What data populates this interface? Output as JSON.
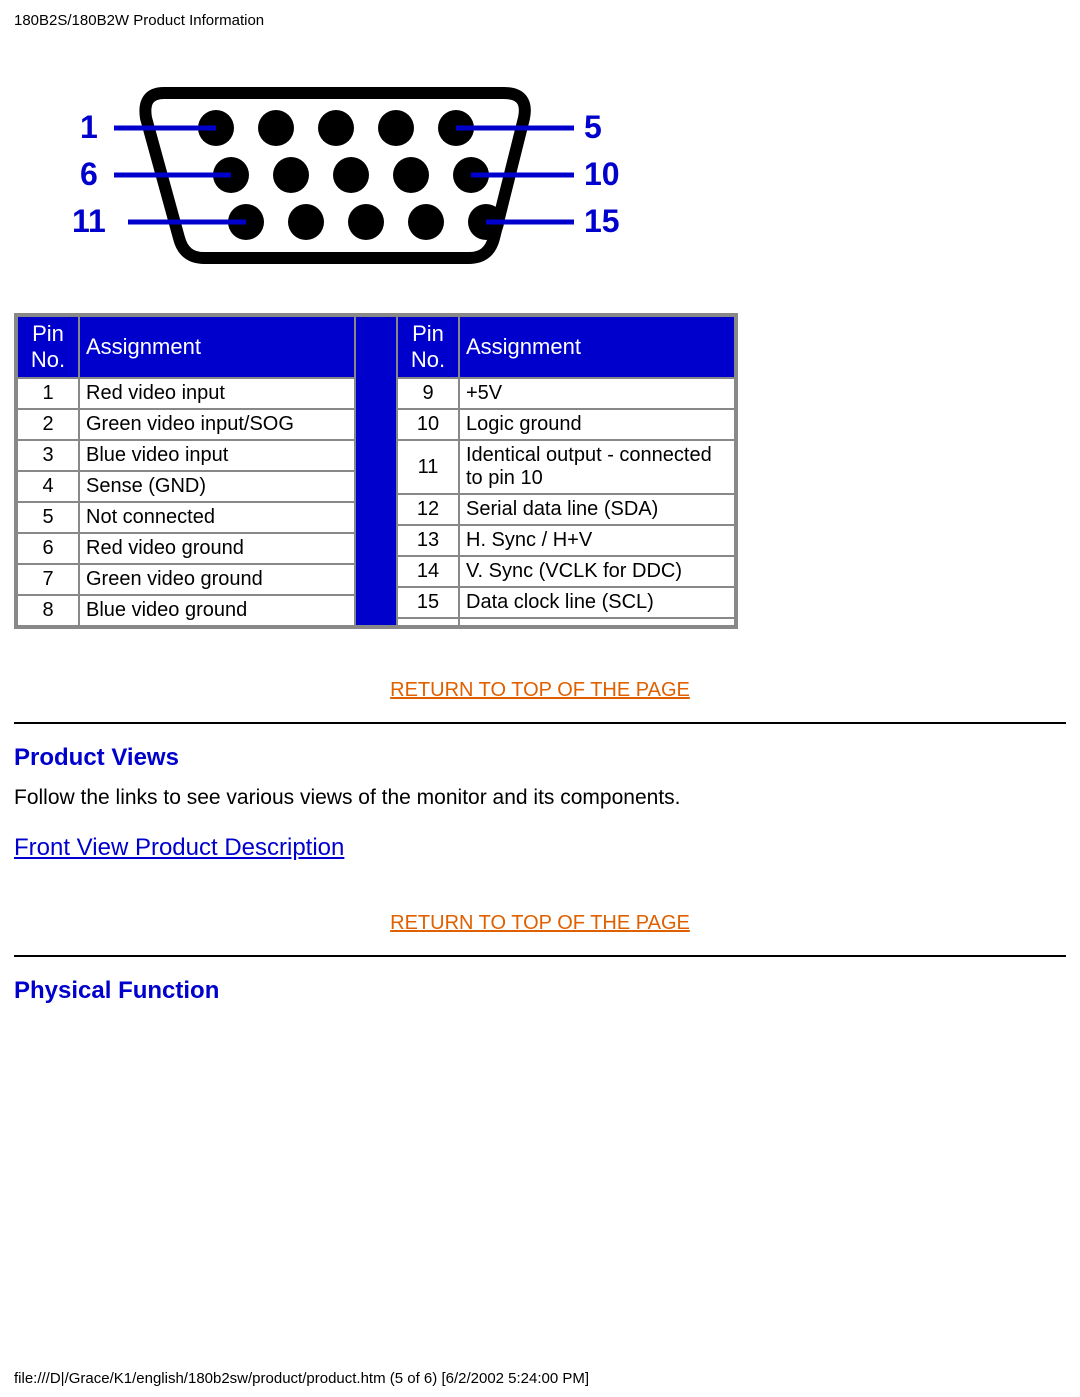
{
  "header": "180B2S/180B2W Product Information",
  "connector_labels": {
    "left": [
      "1",
      "6",
      "11"
    ],
    "right": [
      "5",
      "10",
      "15"
    ]
  },
  "table_header": {
    "pin": "Pin No.",
    "assign": "Assignment"
  },
  "pins_left": [
    {
      "pin": "1",
      "assign": "Red video input"
    },
    {
      "pin": "2",
      "assign": "Green video input/SOG"
    },
    {
      "pin": "3",
      "assign": "Blue video input"
    },
    {
      "pin": "4",
      "assign": "Sense (GND)"
    },
    {
      "pin": "5",
      "assign": "Not connected"
    },
    {
      "pin": "6",
      "assign": "Red video ground"
    },
    {
      "pin": "7",
      "assign": "Green video ground"
    },
    {
      "pin": "8",
      "assign": "Blue video ground"
    }
  ],
  "pins_right": [
    {
      "pin": "9",
      "assign": "+5V"
    },
    {
      "pin": "10",
      "assign": "Logic ground"
    },
    {
      "pin": "11",
      "assign": "Identical output - connected to pin 10"
    },
    {
      "pin": "12",
      "assign": "Serial data line (SDA)"
    },
    {
      "pin": "13",
      "assign": "H. Sync / H+V"
    },
    {
      "pin": "14",
      "assign": "V. Sync (VCLK for DDC)"
    },
    {
      "pin": "15",
      "assign": "Data clock line (SCL)"
    },
    {
      "pin": "",
      "assign": ""
    }
  ],
  "links": {
    "return_top": "RETURN TO TOP OF THE PAGE",
    "front_view": "Front View Product Description"
  },
  "sections": {
    "product_views": {
      "title": "Product Views",
      "text": "Follow the links to see various views of the monitor and its components."
    },
    "physical_function": {
      "title": "Physical Function"
    }
  },
  "footer": "file:///D|/Grace/K1/english/180b2sw/product/product.htm (5 of 6) [6/2/2002 5:24:00 PM]"
}
